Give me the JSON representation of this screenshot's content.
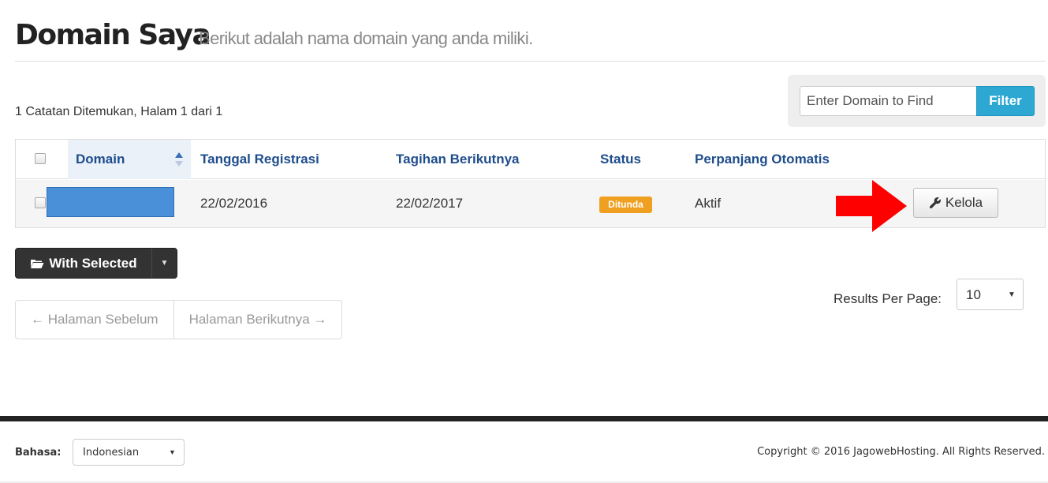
{
  "header": {
    "title": "Domain Saya",
    "subtitle": "Berikut adalah nama domain yang anda miliki."
  },
  "summary": {
    "record_count": "1 Catatan Ditemukan, Halam 1 dari 1"
  },
  "filter": {
    "placeholder": "Enter Domain to Find",
    "button_label": "Filter"
  },
  "table": {
    "columns": [
      "Domain",
      "Tanggal Registrasi",
      "Tagihan Berikutnya",
      "Status",
      "Perpanjang Otomatis"
    ],
    "sorted_column": "Domain",
    "rows": [
      {
        "domain": "",
        "registration_date": "22/02/2016",
        "next_due": "22/02/2017",
        "status": "Ditunda",
        "auto_renew": "Aktif",
        "action_label": "Kelola"
      }
    ]
  },
  "bulk": {
    "label": "With Selected"
  },
  "pagination": {
    "prev_label": "← Halaman Sebelum",
    "next_label": "Halaman Berikutnya →"
  },
  "results_per_page": {
    "label": "Results Per Page:",
    "value": "10"
  },
  "footer": {
    "language_label": "Bahasa:",
    "language_value": "Indonesian",
    "copyright": "Copyright © 2016 JagowebHosting. All Rights Reserved."
  },
  "colors": {
    "accent": "#2ca8d2",
    "header_text": "#1e4d8c",
    "status_pending": "#f0a020",
    "annotation_arrow": "#ff0000"
  },
  "icons": {
    "sort": "sort-asc-icon",
    "manage": "wrench-icon",
    "bulk": "folder-open-icon",
    "annotation": "red-arrow-icon"
  }
}
